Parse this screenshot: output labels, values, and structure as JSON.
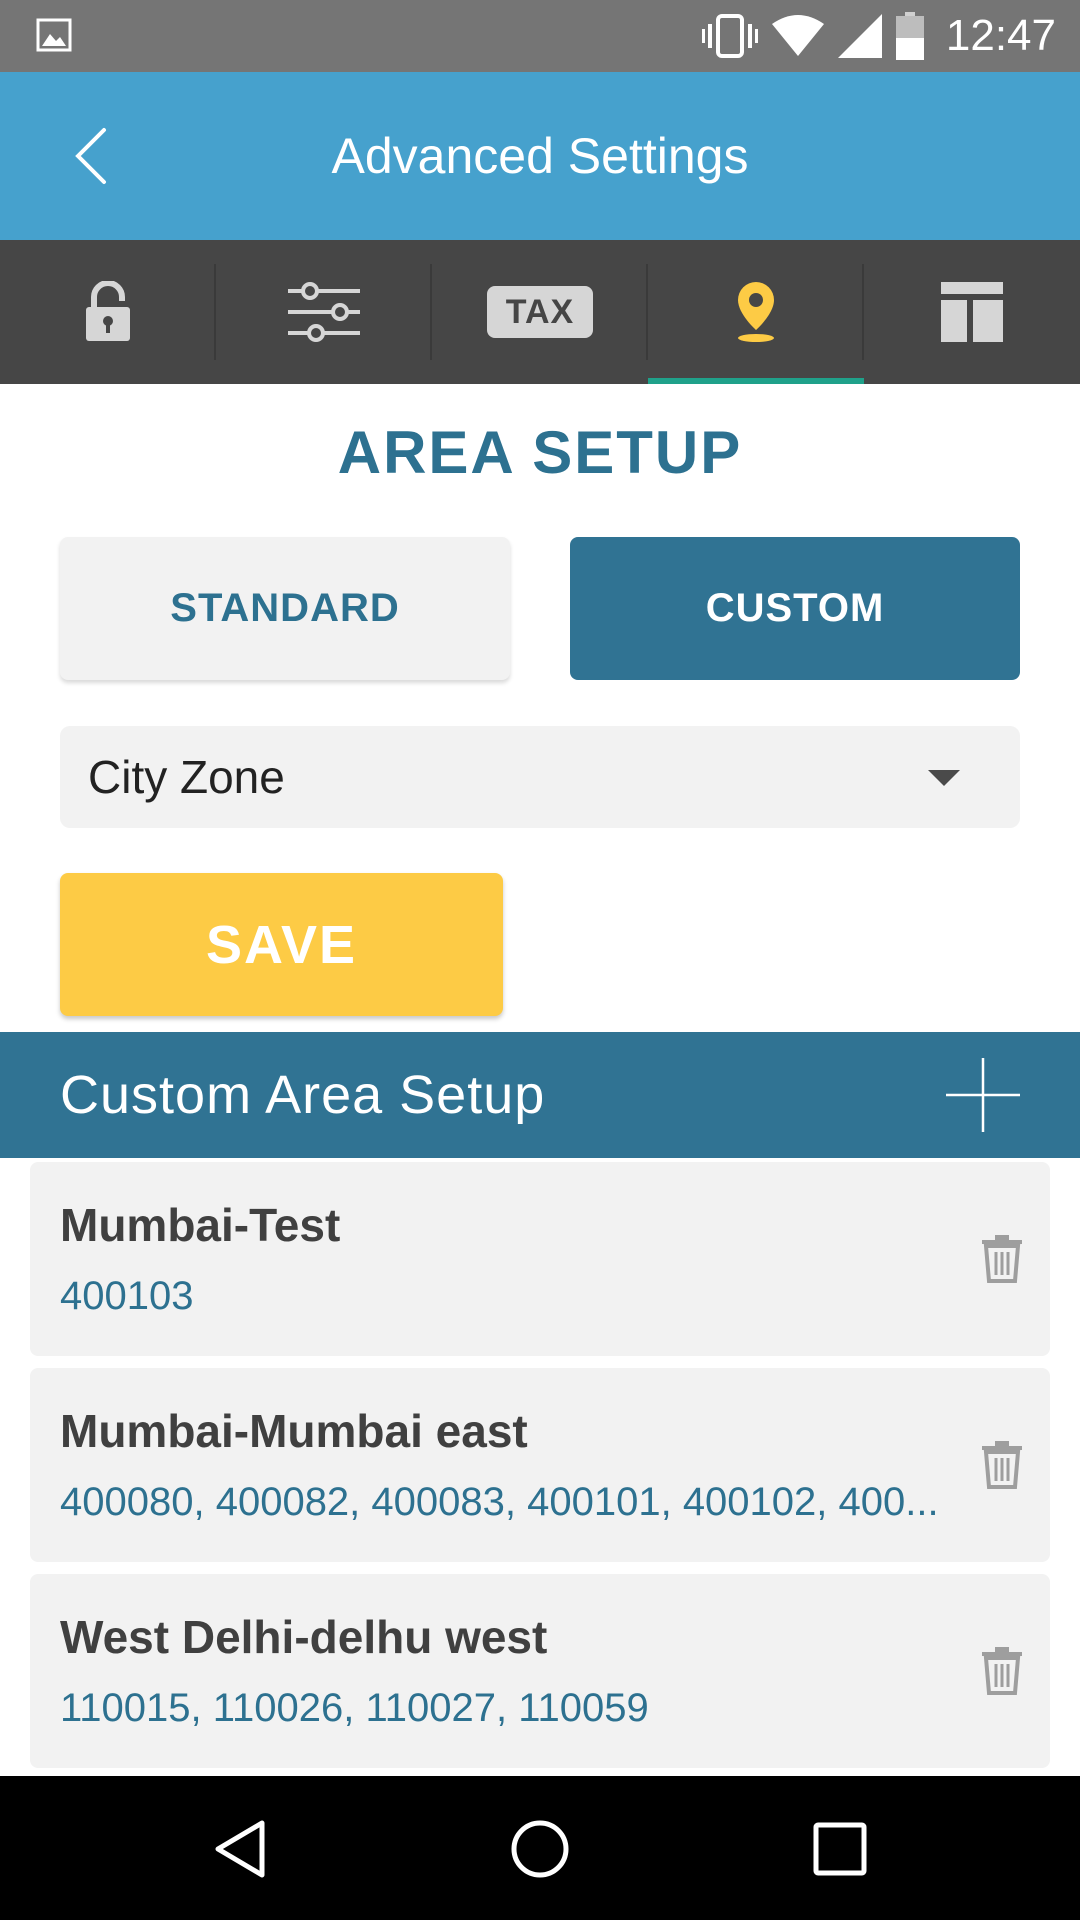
{
  "status_bar": {
    "time": "12:47",
    "icons": [
      "image-icon",
      "vibrate-icon",
      "wifi-icon",
      "signal-icon",
      "battery-icon"
    ]
  },
  "app_bar": {
    "title": "Advanced Settings",
    "back_icon": "chevron-left-icon"
  },
  "tabs": [
    {
      "name": "lock",
      "icon": "unlock-icon",
      "selected": false
    },
    {
      "name": "sliders",
      "icon": "sliders-icon",
      "selected": false
    },
    {
      "name": "tax",
      "label": "TAX",
      "selected": false
    },
    {
      "name": "location",
      "icon": "location-pin-icon",
      "selected": true
    },
    {
      "name": "layout",
      "icon": "layout-icon",
      "selected": false
    }
  ],
  "area_setup": {
    "title": "AREA SETUP",
    "standard_label": "STANDARD",
    "custom_label": "CUSTOM",
    "selected_mode": "CUSTOM",
    "zone_value": "City Zone",
    "save_label": "SAVE"
  },
  "custom_area": {
    "header": "Custom Area Setup",
    "add_icon": "plus-icon",
    "items": [
      {
        "name": "Mumbai-Test",
        "codes": "400103"
      },
      {
        "name": "Mumbai-Mumbai east",
        "codes": "400080, 400082, 400083, 400101, 400102, 400..."
      },
      {
        "name": "West Delhi-delhu west",
        "codes": "110015, 110026, 110027, 110059"
      }
    ]
  },
  "colors": {
    "app_bar": "#46a1cd",
    "tab_bar": "#464646",
    "accent_blue": "#307393",
    "title_blue": "#2d7190",
    "save_yellow": "#fdcb45",
    "active_pin": "#fdcb45",
    "tab_underline": "#1fa18a"
  },
  "nav_bar": {
    "icons": [
      "back-triangle-icon",
      "home-circle-icon",
      "recents-square-icon"
    ]
  }
}
